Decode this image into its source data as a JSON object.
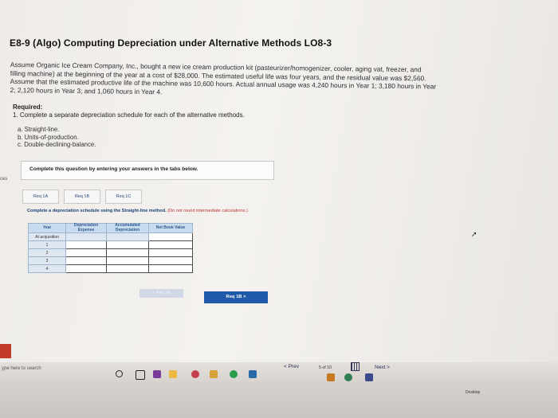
{
  "title": "E8-9 (Algo) Computing Depreciation under Alternative Methods LO8-3",
  "paragraph": "Assume Organic Ice Cream Company, Inc., bought a new ice cream production kit (pasteurizer/homogenizer, cooler, aging vat, freezer, and filling machine) at the beginning of the year at a cost of $28,000. The estimated useful life was four years, and the residual value was $2,560. Assume that the estimated productive life of the machine was 10,600 hours. Actual annual usage was 4,240 hours in Year 1; 3,180 hours in Year 2; 2,120 hours in Year 3; and 1,060 hours in Year 4.",
  "required_heading": "Required:",
  "required_line": "1. Complete a separate depreciation schedule for each of the alternative methods.",
  "options": [
    "a. Straight-line.",
    "b. Units-of-production.",
    "c. Double-declining-balance."
  ],
  "instruction_box": "Complete this question by entering your answers in the tabs below.",
  "side_label": "ces",
  "tabs": [
    "Req 1A",
    "Req 1B",
    "Req 1C"
  ],
  "tab_instruction": "Complete a depreciation schedule using the Straight-line method.",
  "tab_instruction_note": "(Do not round intermediate calculations.)",
  "table": {
    "headers": [
      "Year",
      "Depreciation Expense",
      "Accumulated Depreciation",
      "Net Book Value"
    ],
    "rows": [
      "At acquisition",
      "1",
      "2",
      "3",
      "4"
    ]
  },
  "buttons": {
    "prev": "< Req 1A",
    "next": "Req 1B  >"
  },
  "nav": {
    "prev": "< Prev",
    "page": "5 of 10",
    "next": "Next >"
  },
  "taskbar": {
    "search": "ype here to search",
    "desktop": "Desktop"
  },
  "colors": {
    "accent": "#1f5aa8",
    "table_header": "#c9dbee",
    "logo": "#c23a2a"
  }
}
